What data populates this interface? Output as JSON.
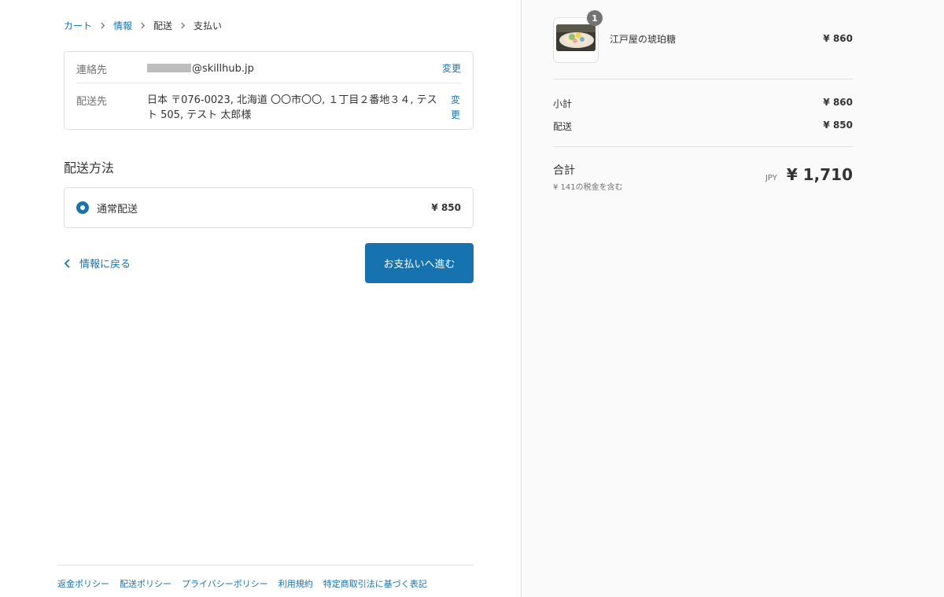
{
  "breadcrumb": {
    "cart": "カート",
    "info": "情報",
    "shipping": "配送",
    "payment": "支払い"
  },
  "review": {
    "contact_label": "連絡先",
    "contact_value": "@skillhub.jp",
    "shipto_label": "配送先",
    "shipto_value": "日本 〒076-0023, 北海道 〇〇市〇〇, １丁目２番地３４, テスト 505, テスト 太郎様",
    "change_label": "変更",
    "change_label_top": "変",
    "change_label_bottom": "更"
  },
  "shipping_method": {
    "title": "配送方法",
    "option_name": "通常配送",
    "option_price": "¥ 850"
  },
  "nav": {
    "back_label": "情報に戻る",
    "continue_label": "お支払いへ進む"
  },
  "footer": {
    "links": [
      "返金ポリシー",
      "配送ポリシー",
      "プライバシーポリシー",
      "利用規約",
      "特定商取引法に基づく表記"
    ]
  },
  "order": {
    "product_name": "江戸屋の琥珀糖",
    "product_price": "¥ 860",
    "quantity": "1",
    "subtotal_label": "小計",
    "subtotal_value": "¥ 860",
    "shipping_label": "配送",
    "shipping_value": "¥ 850",
    "total_label": "合計",
    "tax_note": "¥ 141の税金を含む",
    "currency": "JPY",
    "total_value": "¥ 1,710"
  },
  "colors": {
    "accent": "#1773b0",
    "text": "#333333",
    "muted": "#717171",
    "border": "#dedede",
    "sidebar_bg": "#fafafa"
  },
  "icons": {
    "breadcrumb_separator": "chevron-right-icon",
    "back": "chevron-left-icon",
    "radio": "radio-selected-icon"
  }
}
